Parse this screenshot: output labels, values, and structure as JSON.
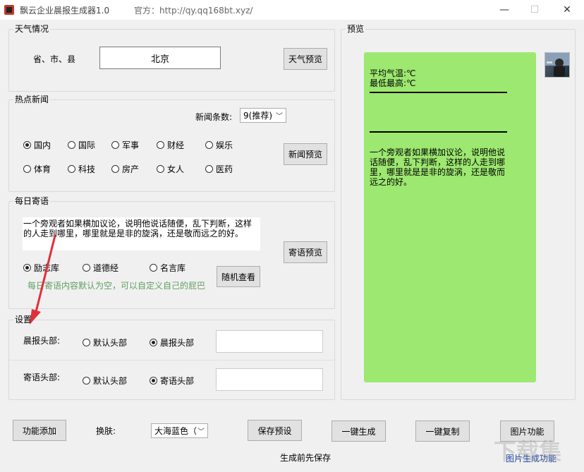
{
  "window": {
    "title": "飘云企业晨报生成器1.0",
    "website": "官方：http://qy.qq168bt.xyz/",
    "minimize_glyph": "—",
    "maximize_glyph": "☐",
    "close_glyph": "✕"
  },
  "weather": {
    "group_title": "天气情况",
    "location_label": "省、市、县",
    "location_value": "北京",
    "preview_button": "天气预览"
  },
  "news": {
    "group_title": "热点新闻",
    "count_label": "新闻条数:",
    "count_value": "9(推荐)",
    "categories": [
      {
        "label": "国内",
        "selected": true
      },
      {
        "label": "国际",
        "selected": false
      },
      {
        "label": "军事",
        "selected": false
      },
      {
        "label": "财经",
        "selected": false
      },
      {
        "label": "娱乐",
        "selected": false
      },
      {
        "label": "体育",
        "selected": false
      },
      {
        "label": "科技",
        "selected": false
      },
      {
        "label": "房产",
        "selected": false
      },
      {
        "label": "女人",
        "selected": false
      },
      {
        "label": "医药",
        "selected": false
      }
    ],
    "preview_button": "新闻预览"
  },
  "message": {
    "group_title": "每日寄语",
    "text_line1": "一个旁观者如果横加议论，说明他说话随便，乱下判断，这样",
    "text_line2": "的人走到哪里，哪里就是是非的旋涡，还是敬而远之的好。",
    "libraries": [
      {
        "label": "励志库",
        "selected": true
      },
      {
        "label": "道德经",
        "selected": false
      },
      {
        "label": "名言库",
        "selected": false
      }
    ],
    "hint": "每日寄语内容默认为空，可以自定义自己的屁巴",
    "preview_button": "寄语预览",
    "random_button": "随机查看"
  },
  "settings": {
    "group_title": "设置",
    "header_label": "晨报头部:",
    "header_default": "默认头部",
    "header_custom": "晨报头部",
    "message_label": "寄语头部:",
    "message_default": "默认头部",
    "message_custom": "寄语头部"
  },
  "preview": {
    "group_title": "预览",
    "avg_temp": "平均气温:℃",
    "min_temp": "最低最高:℃",
    "message_lines": [
      "一个旁观者如果横加议论，说明他说",
      "话随便，乱下判断，这样的人走到哪",
      "里，哪里就是是非的旋涡，还是敬而",
      "远之的好。"
    ]
  },
  "footer": {
    "add_feature": "功能添加",
    "skin_label": "换肤:",
    "skin_value": "大海蓝色（",
    "save_preset": "保存预设",
    "generate": "一键生成",
    "copy": "一键复制",
    "image_feature": "图片功能",
    "save_note": "生成前先保存",
    "image_caption": "图片生成功能"
  },
  "colors": {
    "bubble": "#9de870",
    "annotation_arrow": "#e0303a",
    "hint_text": "#5f9f5f"
  }
}
